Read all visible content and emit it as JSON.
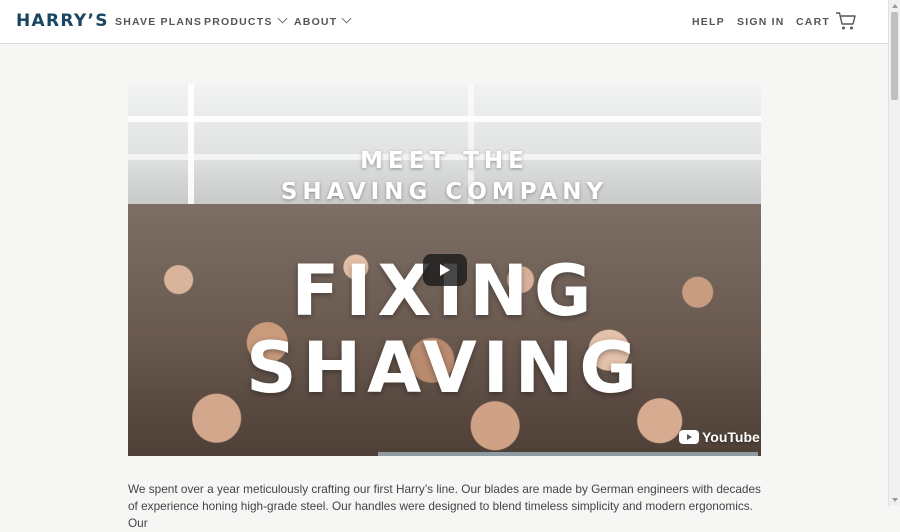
{
  "header": {
    "logo": "HARRY’S",
    "nav": {
      "shave_plans": "SHAVE PLANS",
      "products": "PRODUCTS",
      "about": "ABOUT"
    },
    "help": "HELP",
    "sign_in": "SIGN IN",
    "cart": "CART"
  },
  "video": {
    "overlay_line1": "MEET THE",
    "overlay_line2": "SHAVING COMPANY",
    "overlay_big1": "FIXING",
    "overlay_big2": "SHAVING",
    "provider": "YouTube"
  },
  "main": {
    "paragraph": "We spent over a year meticulously crafting our first Harry’s line. Our blades are made by German engineers with decades of experience honing high-grade steel. Our handles were designed to blend timeless simplicity and modern ergonomics. Our"
  },
  "colors": {
    "brand": "#1a4561",
    "nav_text": "#555555",
    "page_bg": "#f6f6f5"
  },
  "icons": {
    "cart": "cart-icon",
    "play": "play-icon",
    "youtube": "youtube-logo-icon"
  }
}
